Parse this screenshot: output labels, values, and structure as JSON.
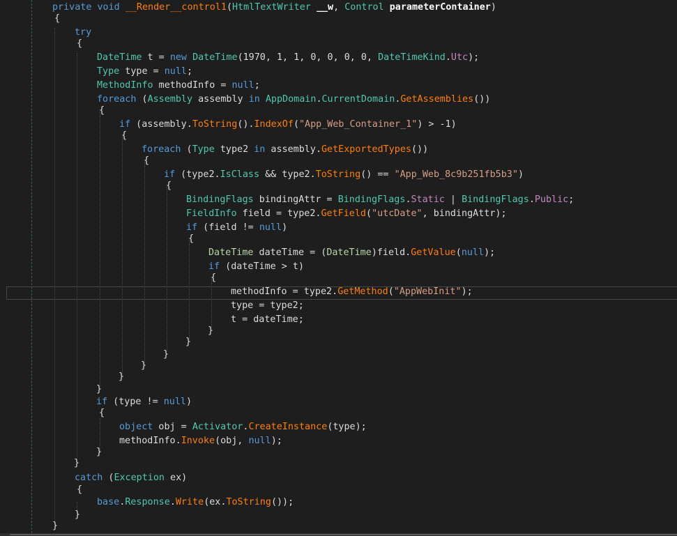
{
  "editor": {
    "lines": [
      [
        {
          "t": "private",
          "c": "kw"
        },
        {
          "t": " "
        },
        {
          "t": "void",
          "c": "kw"
        },
        {
          "t": " "
        },
        {
          "t": "__Render__control1",
          "c": "me"
        },
        {
          "t": "("
        },
        {
          "t": "HtmlTextWriter",
          "c": "ty"
        },
        {
          "t": " "
        },
        {
          "t": "__w",
          "c": "pb"
        },
        {
          "t": ", "
        },
        {
          "t": "Control",
          "c": "ty"
        },
        {
          "t": " "
        },
        {
          "t": "parameterContainer",
          "c": "pb"
        },
        {
          "t": ")"
        }
      ],
      [
        {
          "t": "{"
        }
      ],
      [
        {
          "t": "try",
          "c": "kw"
        }
      ],
      [
        {
          "t": "{"
        }
      ],
      [
        {
          "t": "DateTime",
          "c": "ty"
        },
        {
          "t": " t = "
        },
        {
          "t": "new",
          "c": "kw"
        },
        {
          "t": " "
        },
        {
          "t": "DateTime",
          "c": "ty"
        },
        {
          "t": "(1970, 1, 1, 0, 0, 0, 0, "
        },
        {
          "t": "DateTimeKind",
          "c": "ty"
        },
        {
          "t": "."
        },
        {
          "t": "Utc",
          "c": "vio"
        },
        {
          "t": ");"
        }
      ],
      [
        {
          "t": "Type",
          "c": "ty"
        },
        {
          "t": " type = "
        },
        {
          "t": "null",
          "c": "kw"
        },
        {
          "t": ";"
        }
      ],
      [
        {
          "t": "MethodInfo",
          "c": "ty"
        },
        {
          "t": " methodInfo = "
        },
        {
          "t": "null",
          "c": "kw"
        },
        {
          "t": ";"
        }
      ],
      [
        {
          "t": "foreach",
          "c": "kw"
        },
        {
          "t": " ("
        },
        {
          "t": "Assembly",
          "c": "ty"
        },
        {
          "t": " assembly "
        },
        {
          "t": "in",
          "c": "kw"
        },
        {
          "t": " "
        },
        {
          "t": "AppDomain",
          "c": "ty"
        },
        {
          "t": "."
        },
        {
          "t": "CurrentDomain",
          "c": "ty"
        },
        {
          "t": "."
        },
        {
          "t": "GetAssemblies",
          "c": "me"
        },
        {
          "t": "())"
        }
      ],
      [
        {
          "t": "{"
        }
      ],
      [
        {
          "t": "if",
          "c": "kw"
        },
        {
          "t": " (assembly."
        },
        {
          "t": "ToString",
          "c": "me"
        },
        {
          "t": "()."
        },
        {
          "t": "IndexOf",
          "c": "me"
        },
        {
          "t": "("
        },
        {
          "t": "\"App_Web_Container_1\"",
          "c": "st"
        },
        {
          "t": ") > -1)"
        }
      ],
      [
        {
          "t": "{"
        }
      ],
      [
        {
          "t": "foreach",
          "c": "kw"
        },
        {
          "t": " ("
        },
        {
          "t": "Type",
          "c": "ty"
        },
        {
          "t": " type2 "
        },
        {
          "t": "in",
          "c": "kw"
        },
        {
          "t": " assembly."
        },
        {
          "t": "GetExportedTypes",
          "c": "me"
        },
        {
          "t": "())"
        }
      ],
      [
        {
          "t": "{"
        }
      ],
      [
        {
          "t": "if",
          "c": "kw"
        },
        {
          "t": " (type2."
        },
        {
          "t": "IsClass",
          "c": "ty"
        },
        {
          "t": " && type2."
        },
        {
          "t": "ToString",
          "c": "me"
        },
        {
          "t": "() == "
        },
        {
          "t": "\"App_Web_8c9b251fb5b3\"",
          "c": "st"
        },
        {
          "t": ")"
        }
      ],
      [
        {
          "t": "{"
        }
      ],
      [
        {
          "t": "BindingFlags",
          "c": "ty"
        },
        {
          "t": " bindingAttr = "
        },
        {
          "t": "BindingFlags",
          "c": "ty"
        },
        {
          "t": "."
        },
        {
          "t": "Static",
          "c": "vio"
        },
        {
          "t": " | "
        },
        {
          "t": "BindingFlags",
          "c": "ty"
        },
        {
          "t": "."
        },
        {
          "t": "Public",
          "c": "vio"
        },
        {
          "t": ";"
        }
      ],
      [
        {
          "t": "FieldInfo",
          "c": "ty"
        },
        {
          "t": " field = type2."
        },
        {
          "t": "GetField",
          "c": "me"
        },
        {
          "t": "("
        },
        {
          "t": "\"utcDate\"",
          "c": "st"
        },
        {
          "t": ", bindingAttr);"
        }
      ],
      [
        {
          "t": "if",
          "c": "kw"
        },
        {
          "t": " (field != "
        },
        {
          "t": "null",
          "c": "kw"
        },
        {
          "t": ")"
        }
      ],
      [
        {
          "t": "{"
        }
      ],
      [
        {
          "t": "DateTime",
          "c": "en"
        },
        {
          "t": " dateTime = ("
        },
        {
          "t": "DateTime",
          "c": "en"
        },
        {
          "t": ")field."
        },
        {
          "t": "GetValue",
          "c": "me"
        },
        {
          "t": "("
        },
        {
          "t": "null",
          "c": "kw"
        },
        {
          "t": ");"
        }
      ],
      [
        {
          "t": "if",
          "c": "kw"
        },
        {
          "t": " (dateTime > t)"
        }
      ],
      [
        {
          "t": "{"
        }
      ],
      [
        {
          "t": "methodInfo = type2."
        },
        {
          "t": "GetMethod",
          "c": "me"
        },
        {
          "t": "("
        },
        {
          "t": "\"AppWebInit\"",
          "c": "st"
        },
        {
          "t": ");"
        }
      ],
      [
        {
          "t": "type = type2;"
        }
      ],
      [
        {
          "t": "t = dateTime;"
        }
      ],
      [
        {
          "t": "}"
        }
      ],
      [
        {
          "t": "}"
        }
      ],
      [
        {
          "t": "}"
        }
      ],
      [
        {
          "t": "}"
        }
      ],
      [
        {
          "t": "}"
        }
      ],
      [
        {
          "t": "}"
        }
      ],
      [
        {
          "t": "if",
          "c": "kw"
        },
        {
          "t": " (type != "
        },
        {
          "t": "null",
          "c": "kw"
        },
        {
          "t": ")"
        }
      ],
      [
        {
          "t": "{"
        }
      ],
      [
        {
          "t": "object",
          "c": "kw"
        },
        {
          "t": " obj = "
        },
        {
          "t": "Activator",
          "c": "ty"
        },
        {
          "t": "."
        },
        {
          "t": "CreateInstance",
          "c": "me"
        },
        {
          "t": "(type);"
        }
      ],
      [
        {
          "t": "methodInfo."
        },
        {
          "t": "Invoke",
          "c": "me"
        },
        {
          "t": "(obj, "
        },
        {
          "t": "null",
          "c": "kw"
        },
        {
          "t": ");"
        }
      ],
      [
        {
          "t": "}"
        }
      ],
      [
        {
          "t": "}"
        }
      ],
      [
        {
          "t": "catch",
          "c": "kw"
        },
        {
          "t": " ("
        },
        {
          "t": "Exception",
          "c": "ty"
        },
        {
          "t": " ex)"
        }
      ],
      [
        {
          "t": "{"
        }
      ],
      [
        {
          "t": "base",
          "c": "kw"
        },
        {
          "t": "."
        },
        {
          "t": "Response",
          "c": "ty"
        },
        {
          "t": "."
        },
        {
          "t": "Write",
          "c": "me"
        },
        {
          "t": "(ex."
        },
        {
          "t": "ToString",
          "c": "me"
        },
        {
          "t": "());"
        }
      ],
      [
        {
          "t": "}"
        }
      ],
      [
        {
          "t": "}"
        }
      ]
    ]
  }
}
